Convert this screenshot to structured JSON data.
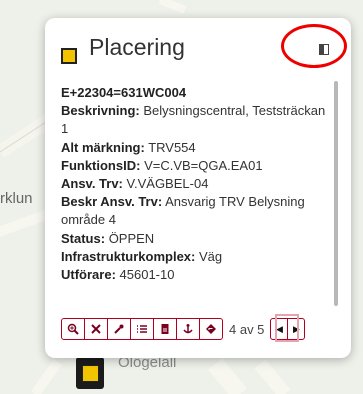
{
  "map": {
    "label_left": "rklun",
    "label_bottom": "Ölögeläll"
  },
  "popup": {
    "title": "Placering",
    "id_line": "E+22304=631WC004",
    "fields": [
      {
        "label": "Beskrivning:",
        "value": "Belysningscentral, Teststräckan 1"
      },
      {
        "label": "Alt märkning:",
        "value": "TRV554"
      },
      {
        "label": "FunktionsID:",
        "value": "V=C.VB=QGA.EA01"
      },
      {
        "label": "Ansv. Trv:",
        "value": "V.VÄGBEL-04"
      },
      {
        "label": "Beskr Ansv. Trv:",
        "value": "Ansvarig TRV Belysning område 4"
      },
      {
        "label": "Status:",
        "value": "ÖPPEN"
      },
      {
        "label": "Infrastrukturkomplex:",
        "value": "Väg"
      },
      {
        "label": "Utförare:",
        "value": "45601-10"
      }
    ],
    "pager": "4 av 5",
    "toolbar_icons": [
      "zoom-in-icon",
      "tools-icon",
      "wrench-icon",
      "list-icon",
      "document-icon",
      "anchor-icon",
      "navigation-icon"
    ]
  },
  "colors": {
    "accent": "#b00020",
    "marker_yellow": "#f2c400",
    "annotation_red": "#e00000"
  }
}
